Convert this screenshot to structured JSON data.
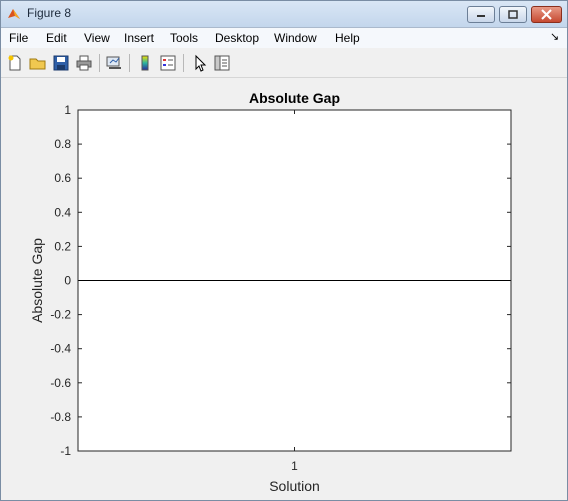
{
  "window": {
    "title": "Figure 8",
    "controls": [
      "minimize",
      "maximize",
      "close"
    ]
  },
  "menubar": {
    "items": [
      "File",
      "Edit",
      "View",
      "Insert",
      "Tools",
      "Desktop",
      "Window",
      "Help"
    ],
    "overflow_icon": "menu-overflow-arrow-icon"
  },
  "toolbar": {
    "tools": [
      "new-figure-icon",
      "open-file-icon",
      "save-icon",
      "print-icon",
      "link-plot-icon",
      "insert-colorbar-icon",
      "insert-legend-icon",
      "edit-plot-arrow-icon",
      "show-plot-tools-icon"
    ]
  },
  "colors": {
    "plot_line": "#000000",
    "axes_bg": "#ffffff",
    "figure_bg": "#f0f0f0"
  },
  "chart_data": {
    "type": "line",
    "title": "Absolute Gap",
    "xlabel": "Solution",
    "ylabel": "Absolute Gap",
    "xlim": [
      0.5,
      1.5
    ],
    "ylim": [
      -1,
      1
    ],
    "x": [
      0.5,
      1.5
    ],
    "series": [
      {
        "values": [
          0,
          0
        ]
      }
    ],
    "xticks": [
      1
    ],
    "xtick_labels": [
      "1"
    ],
    "yticks": [
      -1,
      -0.8,
      -0.6,
      -0.4,
      -0.2,
      0,
      0.2,
      0.4,
      0.6,
      0.8,
      1
    ],
    "ytick_labels": [
      "-1",
      "-0.8",
      "-0.6",
      "-0.4",
      "-0.2",
      "0",
      "0.2",
      "0.4",
      "0.6",
      "0.8",
      "1"
    ],
    "grid": false,
    "legend": "none"
  }
}
